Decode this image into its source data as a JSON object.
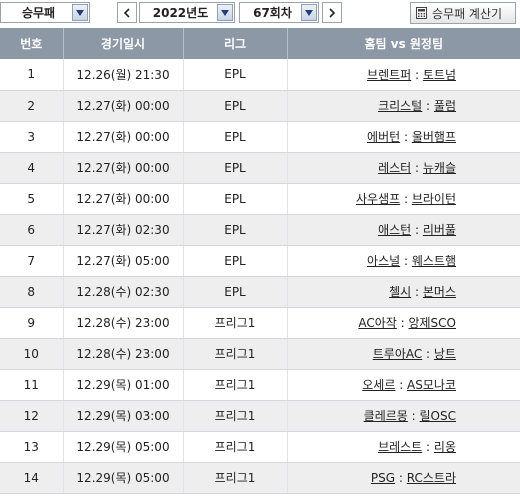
{
  "toolbar": {
    "game_type": "승무패",
    "year": "2022년도",
    "round": "67회차",
    "calc_label": "승무패 계산기"
  },
  "table": {
    "headers": {
      "no": "번호",
      "datetime": "경기일시",
      "league": "리그",
      "match": "홈팀 vs 원정팀"
    },
    "separator": " : ",
    "rows": [
      {
        "no": "1",
        "datetime": "12.26(월) 21:30",
        "league": "EPL",
        "home": "브렌트퍼",
        "away": "토트넘"
      },
      {
        "no": "2",
        "datetime": "12.27(화) 00:00",
        "league": "EPL",
        "home": "크리스털",
        "away": "풀럼"
      },
      {
        "no": "3",
        "datetime": "12.27(화) 00:00",
        "league": "EPL",
        "home": "에버턴",
        "away": "울버햄프"
      },
      {
        "no": "4",
        "datetime": "12.27(화) 00:00",
        "league": "EPL",
        "home": "레스터",
        "away": "뉴캐슬"
      },
      {
        "no": "5",
        "datetime": "12.27(화) 00:00",
        "league": "EPL",
        "home": "사우샘프",
        "away": "브라이턴"
      },
      {
        "no": "6",
        "datetime": "12.27(화) 02:30",
        "league": "EPL",
        "home": "애스턴",
        "away": "리버풀"
      },
      {
        "no": "7",
        "datetime": "12.27(화) 05:00",
        "league": "EPL",
        "home": "아스널",
        "away": "웨스트햄"
      },
      {
        "no": "8",
        "datetime": "12.28(수) 02:30",
        "league": "EPL",
        "home": "첼시",
        "away": "본머스"
      },
      {
        "no": "9",
        "datetime": "12.28(수) 23:00",
        "league": "프리그1",
        "home": "AC아작",
        "away": "앙제SCO"
      },
      {
        "no": "10",
        "datetime": "12.28(수) 23:00",
        "league": "프리그1",
        "home": "트루아AC",
        "away": "낭트"
      },
      {
        "no": "11",
        "datetime": "12.29(목) 01:00",
        "league": "프리그1",
        "home": "오세르",
        "away": "AS모나코"
      },
      {
        "no": "12",
        "datetime": "12.29(목) 03:00",
        "league": "프리그1",
        "home": "클레르몽",
        "away": "릴OSC"
      },
      {
        "no": "13",
        "datetime": "12.29(목) 05:00",
        "league": "프리그1",
        "home": "브레스트",
        "away": "리옹"
      },
      {
        "no": "14",
        "datetime": "12.29(목) 05:00",
        "league": "프리그1",
        "home": "PSG",
        "away": "RC스트라"
      }
    ]
  }
}
